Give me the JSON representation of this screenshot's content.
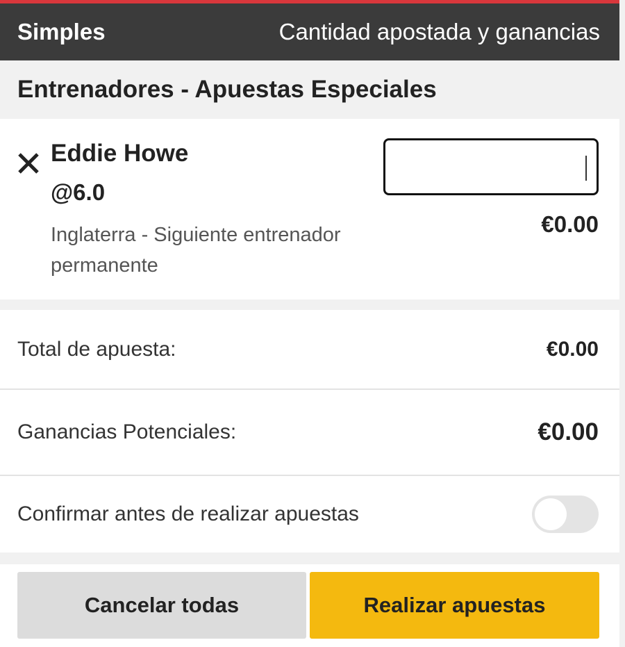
{
  "header": {
    "left_label": "Simples",
    "right_label": "Cantidad apostada y ganancias"
  },
  "section": {
    "title": "Entrenadores - Apuestas Especiales"
  },
  "bet": {
    "selection": "Eddie Howe",
    "odds": "@6.0",
    "market": "Inglaterra - Siguiente entrenador permanente",
    "stake_value": "",
    "amount": "€0.00",
    "remove_icon": "close-icon"
  },
  "summary": {
    "total_label": "Total de apuesta:",
    "total_value": "€0.00",
    "potential_label": "Ganancias Potenciales:",
    "potential_value": "€0.00",
    "confirm_label": "Confirmar antes de realizar apuestas",
    "confirm_enabled": false
  },
  "actions": {
    "cancel_label": "Cancelar todas",
    "place_label": "Realizar apuestas"
  },
  "colors": {
    "top_accent": "#d9373c",
    "header_bg": "#3b3b3b",
    "place_button": "#f4b90f",
    "cancel_button": "#dcdcdc"
  }
}
